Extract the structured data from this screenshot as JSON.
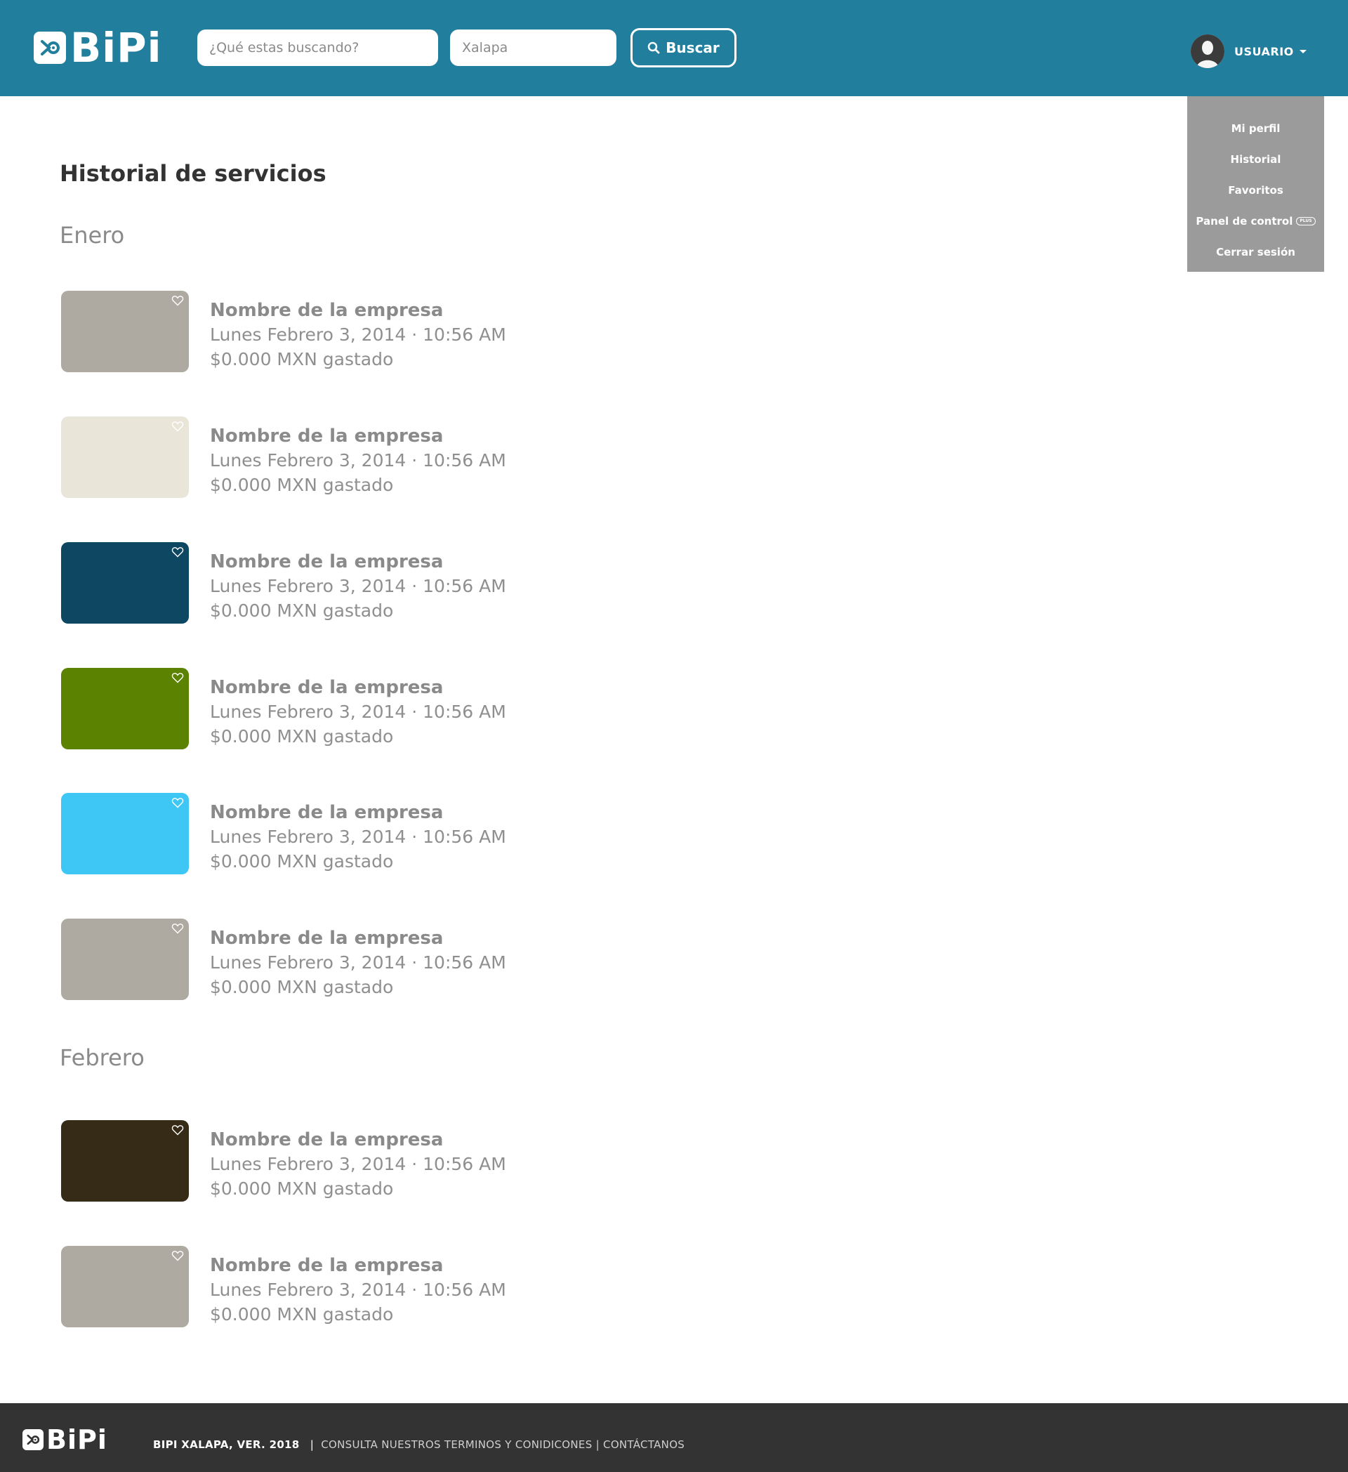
{
  "brand": {
    "name": "BiPi",
    "header_color": "#217e9c"
  },
  "header": {
    "search_placeholder": "¿Qué estas buscando?",
    "location_placeholder": "Xalapa",
    "search_button": "Buscar",
    "user_label": "USUARIO"
  },
  "dropdown": {
    "items": [
      {
        "label": "Mi perfil"
      },
      {
        "label": "Historial"
      },
      {
        "label": "Favoritos"
      },
      {
        "label": "Panel de control",
        "badge": "PLUS"
      },
      {
        "label": "Cerrar sesión"
      }
    ]
  },
  "main": {
    "title": "Historial de servicios",
    "groups": [
      {
        "month": "Enero",
        "items": [
          {
            "name": "Nombre de la empresa",
            "date": "Lunes Febrero 3, 2014 · 10:56 AM",
            "spent": "$0.000 MXN gastado",
            "color": "#aeaaa2"
          },
          {
            "name": "Nombre de la empresa",
            "date": "Lunes Febrero 3, 2014 · 10:56 AM",
            "spent": "$0.000 MXN gastado",
            "color": "#e9e5d8"
          },
          {
            "name": "Nombre de la empresa",
            "date": "Lunes Febrero 3, 2014 · 10:56 AM",
            "spent": "$0.000 MXN gastado",
            "color": "#0e4761"
          },
          {
            "name": "Nombre de la empresa",
            "date": "Lunes Febrero 3, 2014 · 10:56 AM",
            "spent": "$0.000 MXN gastado",
            "color": "#5b8201"
          },
          {
            "name": "Nombre de la empresa",
            "date": "Lunes Febrero 3, 2014 · 10:56 AM",
            "spent": "$0.000 MXN gastado",
            "color": "#3ec7f4"
          },
          {
            "name": "Nombre de la empresa",
            "date": "Lunes Febrero 3, 2014 · 10:56 AM",
            "spent": "$0.000 MXN gastado",
            "color": "#aeaaa2"
          }
        ]
      },
      {
        "month": "Febrero",
        "items": [
          {
            "name": "Nombre de la empresa",
            "date": "Lunes Febrero 3, 2014 · 10:56 AM",
            "spent": "$0.000 MXN gastado",
            "color": "#352b17"
          },
          {
            "name": "Nombre de la empresa",
            "date": "Lunes Febrero 3, 2014 · 10:56 AM",
            "spent": "$0.000 MXN gastado",
            "color": "#aeaaa2"
          }
        ]
      }
    ]
  },
  "footer": {
    "copyright": "BIPI XALAPA, VER.  2018",
    "separator": "|",
    "terms_link": "CONSULTA NUESTROS TERMINOS Y CONIDICONES",
    "contact_link": "CONTÁCTANOS",
    "background": "#333333"
  }
}
